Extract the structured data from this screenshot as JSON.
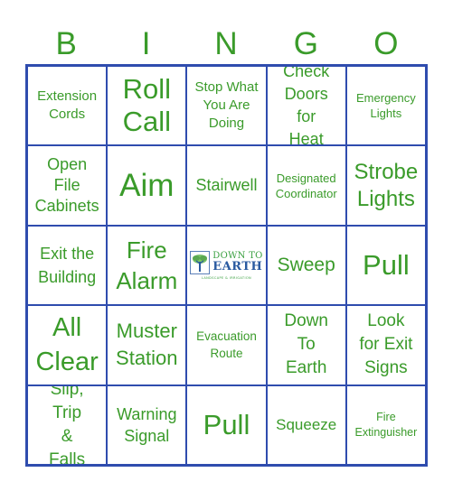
{
  "header": {
    "letters": [
      "B",
      "I",
      "N",
      "G",
      "O"
    ]
  },
  "colors": {
    "text": "#3a9b2a",
    "border": "#2f4cae",
    "logo_blue": "#2a5aa0",
    "logo_green": "#3aa040"
  },
  "cells": [
    [
      "Extension Cords",
      "Roll Call",
      "Stop What You Are Doing",
      "Check Doors for Heat",
      "Emergency Lights"
    ],
    [
      "Open File Cabinets",
      "Aim",
      "Stairwell",
      "Designated Coordinator",
      "Strobe Lights"
    ],
    [
      "Exit the Building",
      "Fire Alarm",
      "",
      "Sweep",
      "Pull"
    ],
    [
      "All Clear",
      "Muster Station",
      "Evacuation Route",
      "Down To Earth",
      "Look for Exit Signs"
    ],
    [
      "Slip, Trip & Falls",
      "Warning Signal",
      "Pull",
      "Squeeze",
      "Fire Extinguisher"
    ]
  ],
  "free_space": {
    "logo_icon": "tree-icon",
    "line1": "DOWN TO",
    "line2": "EARTH",
    "tagline": "LANDSCAPE & IRRIGATION"
  }
}
